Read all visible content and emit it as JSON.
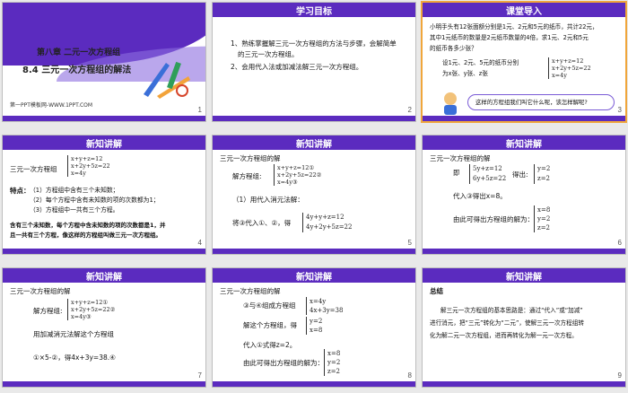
{
  "slides": [
    {
      "num": "1",
      "chapter": "第八章  二元一次方程组",
      "section": "8.4 三元一次方程组的解法",
      "site": "第一PPT模板网-WWW.1PPT.COM"
    },
    {
      "num": "2",
      "header": "学习目标",
      "lines": [
        "1、熟练掌握解三元一次方程组的方法与步骤，会解简单",
        "的三元一次方程组。",
        "2、会用代入法或加减法解三元一次方程组。"
      ]
    },
    {
      "num": "3",
      "header": "课堂导入",
      "lines": [
        "小明手头有12张面额分别是1元、2元和5元的纸币，共计22元，",
        "其中1元纸币的数量是2元纸币数量的4倍，求1元、2元和5元",
        "的纸币各多少张？"
      ],
      "setup": [
        "设1元、2元、5元的纸币分别",
        "为x张、y张、z张"
      ],
      "sys": [
        "x+y+z=12",
        "x+2y+5z=22",
        "x=4y"
      ],
      "bubble": "这样的方程组我们叫它什么呢，该怎样解呢?"
    },
    {
      "num": "4",
      "header": "新知讲解",
      "label": "三元一次方程组",
      "sys": [
        "x+y+z=12",
        "x+2y+5z=22",
        "x=4y"
      ],
      "feat_title": "特点：",
      "feats": [
        "（1）方程组中含有三个未知数；",
        "（2）每个方程中含有未知数的项的次数都为1；",
        "（3）方程组中一共有三个方程。"
      ],
      "concl": [
        "含有三个未知数，每个方程中含未知数的项的次数都是1，并",
        "且一共有三个方程，像这样的方程组叫做三元一次方程组。"
      ]
    },
    {
      "num": "5",
      "header": "新知讲解",
      "l1": "三元一次方程组的解",
      "l2": "解方程组:",
      "sys": [
        "x+y+z=12①",
        "x+2y+5z=22②",
        "x=4y③"
      ],
      "l3": "（1）用代入消元法解：",
      "l4": "将③代入①、②，得",
      "sys2": [
        "4y+y+z=12",
        "4y+2y+5z=22"
      ]
    },
    {
      "num": "6",
      "header": "新知讲解",
      "l1": "三元一次方程组的解",
      "l2": "即",
      "sys": [
        "5y+z=12",
        "6y+5z=22"
      ],
      "l3": "得出:",
      "sys2": [
        "y=2",
        "z=2"
      ],
      "l4": "代入③得出x=8。",
      "l5": "由此可得出方程组的解为：",
      "sys3": [
        "x=8",
        "y=2",
        "z=2"
      ]
    },
    {
      "num": "7",
      "header": "新知讲解",
      "l1": "三元一次方程组的解",
      "l2": "解方程组:",
      "sys": [
        "x+y+z=12①",
        "x+2y+5z=22②",
        "x=4y③"
      ],
      "l3": "用加减消元法解这个方程组",
      "l4": "①×5-②，得4x+3y=38.④"
    },
    {
      "num": "8",
      "header": "新知讲解",
      "l1": "三元一次方程组的解",
      "l2": "③与④组成方程组",
      "sys": [
        "x=4y",
        "4x+3y=38"
      ],
      "l3": "解这个方程组，得",
      "sys2": [
        "y=2",
        "x=8"
      ],
      "l4": "代入①式得z=2。",
      "l5": "由此可得出方程组的解为：",
      "sys3": [
        "x=8",
        "y=2",
        "z=2"
      ]
    },
    {
      "num": "9",
      "header": "新知讲解",
      "l1": "总结",
      "lines": [
        "解三元一次方程组的基本思路是：通过“代入”或“加减”",
        "进行消元，把“三元”转化为“二元”，使解三元一次方程组转",
        "化为解二元一次方程组，进而再转化为解一元一次方程。"
      ]
    }
  ]
}
